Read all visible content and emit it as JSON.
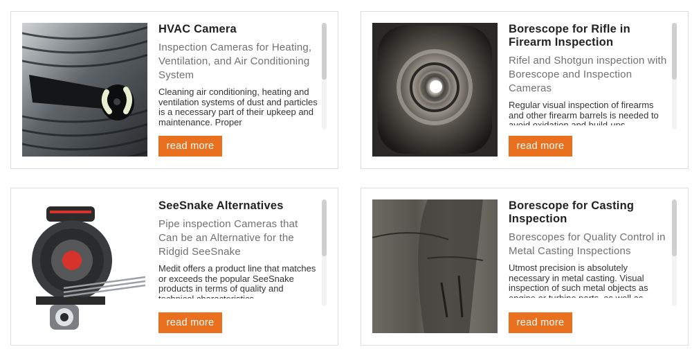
{
  "cards": [
    {
      "title": "HVAC Camera",
      "subtitle": "Inspection Cameras for Heating, Ventilation, and Air Conditioning System",
      "description": "Cleaning air conditioning, heating and ventilation systems of dust and particles is a necessary part of their upkeep and maintenance. Proper",
      "button": "read more",
      "image": "hvac-duct-camera-photo"
    },
    {
      "title": "Borescope for Rifle in Firearm Inspection",
      "subtitle": "Rifel and Shotgun inspection with Borescope and Inspection Cameras",
      "description": "Regular visual inspection of firearms and other firearm barrels is needed to avoid oxidation and build-ups",
      "button": "read more",
      "image": "rifle-barrel-bore-photo"
    },
    {
      "title": "SeeSnake Alternatives",
      "subtitle": "Pipe inspection Cameras that Can be an Alternative for the Ridgid SeeSnake",
      "description": "Medit offers a product line that matches or exceeds the popular SeeSnake products in terms of quality and technical characteristics",
      "button": "read more",
      "image": "pipe-inspection-reel-photo"
    },
    {
      "title": "Borescope for Casting Inspection",
      "subtitle": "Borescopes for Quality Control in Metal Casting Inspections",
      "description": "Utmost precision is absolutely necessary in metal casting. Visual inspection of such metal objects as engine or turbine parts, as well as",
      "button": "read more",
      "image": "metal-casting-interior-photo"
    }
  ],
  "colors": {
    "button_bg": "#e8701e",
    "button_text": "#ffffff",
    "title": "#222222",
    "subtitle": "#707070",
    "card_border": "#dcdcdc"
  }
}
